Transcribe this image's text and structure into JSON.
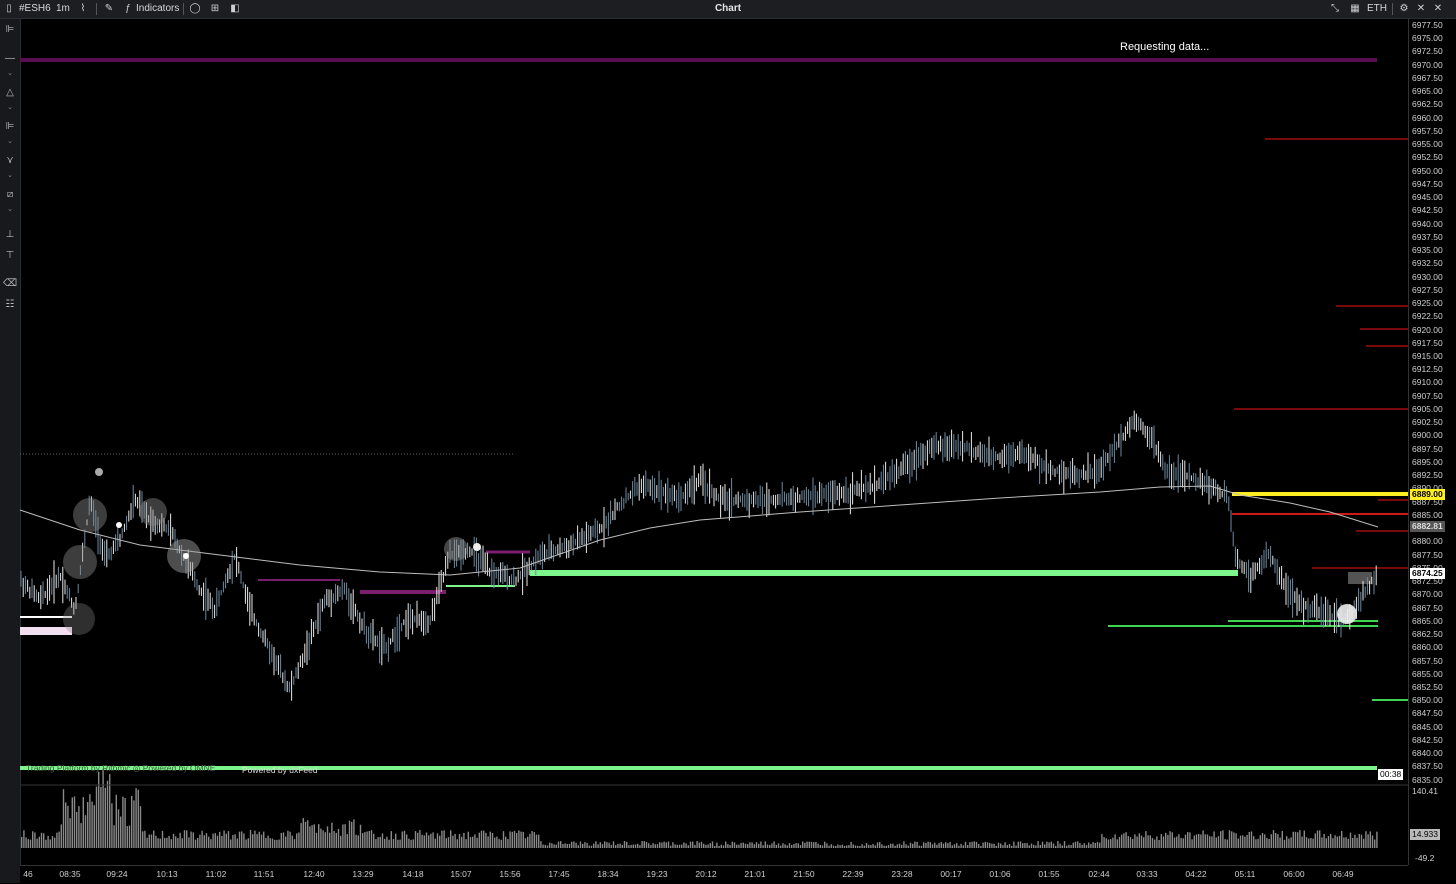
{
  "topbar": {
    "symbol": "#ESH6",
    "interval": "1m",
    "indicators_label": "Indicators",
    "title": "Chart",
    "session": "ETH"
  },
  "chart": {
    "status_text": "Requesting data...",
    "watermark_text": "Trading Platform by Rithmic",
    "watermark_text2": "Powered by OMNE",
    "powered_text": "Powered by dxFeed",
    "countdown": "00:38",
    "current_price": "6874.25",
    "level_yellow": "6889.00",
    "level_gray": "6882.81"
  },
  "price_axis": {
    "ticks": [
      "6977.50",
      "6975.00",
      "6972.50",
      "6970.00",
      "6967.50",
      "6965.00",
      "6962.50",
      "6960.00",
      "6957.50",
      "6955.00",
      "6952.50",
      "6950.00",
      "6947.50",
      "6945.00",
      "6942.50",
      "6940.00",
      "6937.50",
      "6935.00",
      "6932.50",
      "6930.00",
      "6927.50",
      "6925.00",
      "6922.50",
      "6920.00",
      "6917.50",
      "6915.00",
      "6912.50",
      "6910.00",
      "6907.50",
      "6905.00",
      "6902.50",
      "6900.00",
      "6897.50",
      "6895.00",
      "6892.50",
      "6890.00",
      "6887.50",
      "6885.00",
      "6882.50",
      "6880.00",
      "6877.50",
      "6875.00",
      "6872.50",
      "6870.00",
      "6867.50",
      "6865.00",
      "6862.50",
      "6860.00",
      "6857.50",
      "6855.00",
      "6852.50",
      "6850.00",
      "6847.50",
      "6845.00",
      "6842.50",
      "6840.00",
      "6837.50",
      "6835.00"
    ]
  },
  "volume_axis": {
    "top": "140.41",
    "current": "14.933",
    "bottom": "-49.2"
  },
  "time_axis": {
    "labels": [
      "46",
      "08:35",
      "09:24",
      "10:13",
      "11:02",
      "11:51",
      "12:40",
      "13:29",
      "14:18",
      "15:07",
      "15:56",
      "17:45",
      "18:34",
      "19:23",
      "20:12",
      "21:01",
      "21:50",
      "22:39",
      "23:28",
      "00:17",
      "01:06",
      "01:55",
      "02:44",
      "03:33",
      "04:22",
      "05:11",
      "06:00",
      "06:49"
    ]
  },
  "colors": {
    "green": "#7df58c",
    "yellow": "#ffee22",
    "red": "#d01818",
    "purple": "#5a0e52",
    "background": "#000000"
  }
}
